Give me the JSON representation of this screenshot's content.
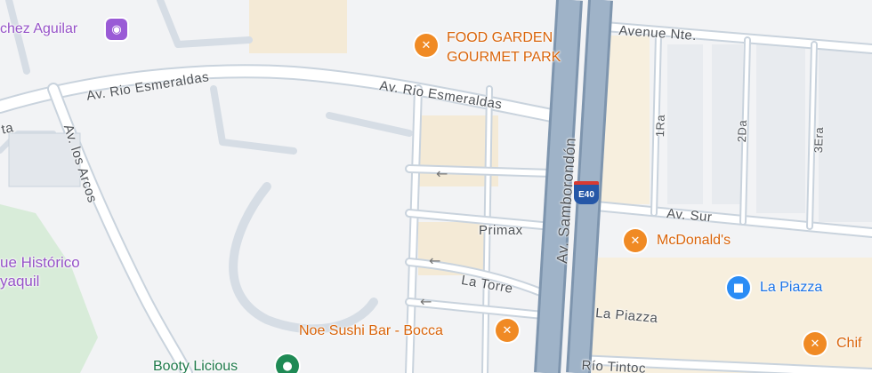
{
  "colors": {
    "background": "#f2f3f5",
    "road": "#ffffff",
    "road_outline": "#c9d3dd",
    "highway": "#8fa6bf",
    "block": "#f4ead6",
    "park": "#d8ecd9"
  },
  "roads": {
    "rio_esmeraldas_left": "Av. Rio Esmeraldas",
    "rio_esmeraldas_right": "Av. Rio Esmeraldas",
    "avenue_nte": "Avenue Nte.",
    "los_arcos": "Av. los Arcos",
    "samborondon": "Av. Samborondón",
    "primax": "Primax",
    "la_torre": "La Torre",
    "av_sur": "Av. Sur",
    "la_piazza_road": "La Piazza",
    "rio_tinto": "Río Tintoc",
    "one_ra": "1Ra",
    "two_da": "2Da",
    "three_era": "3Era",
    "left_edge": "ta"
  },
  "places": {
    "chez_aguilar": "chez Aguilar",
    "food_garden_line1": "FOOD GARDEN",
    "food_garden_line2": "GOURMET PARK",
    "mcdonalds": "McDonald's",
    "la_piazza": "La Piazza",
    "noe_sushi": "Noe Sushi Bar - Bocca",
    "booty_licious": "Booty Licious",
    "parque_line1": "ue Histórico",
    "parque_line2": "yaquil",
    "chif": "Chif"
  },
  "highway_shield": "E40",
  "icons": {
    "restaurant": "fork-knife-icon",
    "shopping": "shopping-bag-icon",
    "bar": "cocktail-icon",
    "park": "tree-icon",
    "one_way": "arrow-left-icon"
  }
}
